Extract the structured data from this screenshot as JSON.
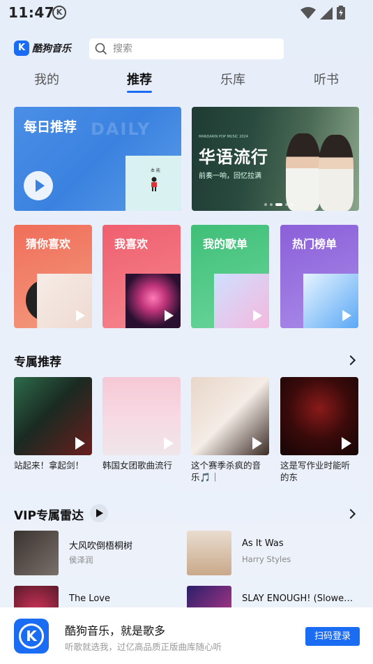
{
  "status_bar": {
    "time": "11:47",
    "app_badge": "K",
    "icons": [
      "wifi-icon",
      "signal-icon",
      "battery-charging-icon"
    ]
  },
  "header": {
    "logo_badge": "K",
    "logo_text": "酷狗音乐",
    "search_placeholder": "搜索"
  },
  "tabs": [
    {
      "label": "我的",
      "active": false
    },
    {
      "label": "推荐",
      "active": true
    },
    {
      "label": "乐库",
      "active": false
    },
    {
      "label": "听书",
      "active": false
    }
  ],
  "banners": {
    "daily": {
      "title": "每日推荐",
      "ghost_text": "DAILY",
      "cover_text": "本 能"
    },
    "chinese": {
      "small_text": "MANDARIN POP MUSIC 2024",
      "title": "华语流行",
      "subtitle": "前奏一响，回忆拉满"
    }
  },
  "quick_cards": [
    {
      "title": "猜你喜欢",
      "color_start": "#f06e5a",
      "color_end": "#f39a7e"
    },
    {
      "title": "我喜欢",
      "color_start": "#ef5f6f",
      "color_end": "#f5868e"
    },
    {
      "title": "我的歌单",
      "color_start": "#3fbf78",
      "color_end": "#6bd59b"
    },
    {
      "title": "热门榜单",
      "color_start": "#8b5fd9",
      "color_end": "#a98be8"
    }
  ],
  "exclusive": {
    "title": "专属推荐",
    "items": [
      {
        "text": "站起来！拿起剑！"
      },
      {
        "text": "韩国女团歌曲流行"
      },
      {
        "text": "这个赛季杀疯的音乐🎵｜"
      },
      {
        "text": "这是写作业时能听的东西！！？！？…"
      }
    ]
  },
  "vip": {
    "title": "VIP专属雷达",
    "songs": [
      {
        "title": "大风吹倒梧桐树",
        "artist": "侯泽润"
      },
      {
        "title": "As It Was",
        "artist": "Harry Styles"
      },
      {
        "title": "The Love",
        "artist": ""
      },
      {
        "title": "SLAY ENOUGH! (Slowed +…",
        "artist": ""
      }
    ]
  },
  "bottom_banner": {
    "logo_letter": "K",
    "title": "酷狗音乐，就是歌多",
    "subtitle": "听歌就选我，过亿高品质正版曲库随心听",
    "button": "扫码登录"
  },
  "colors": {
    "accent": "#1a6cf2",
    "background": "#e9eff9"
  }
}
